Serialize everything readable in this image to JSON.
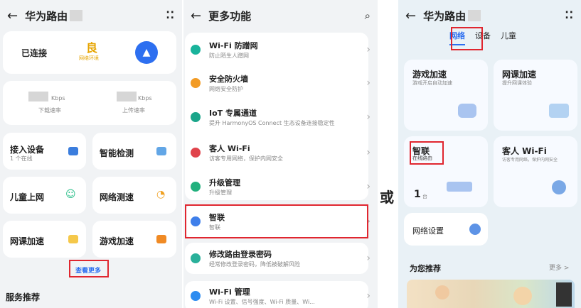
{
  "panel1": {
    "title": "华为路由",
    "connection": "已连接",
    "quality": "良",
    "quality_sub": "网络环境",
    "speed_unit": "Kbps",
    "download_label": "下载速率",
    "upload_label": "上传速率",
    "devices": {
      "label": "接入设备",
      "count": "1 个在线"
    },
    "tiles": [
      "智能检测",
      "儿童上网",
      "网络测速",
      "网课加速",
      "游戏加速"
    ],
    "more_link": "查看更多",
    "section": "服务推荐"
  },
  "panel2": {
    "title": "更多功能",
    "items": [
      {
        "title": "Wi-Fi 防蹭网",
        "desc": "防止陌生人蹭网",
        "color": "#19b39b"
      },
      {
        "title": "安全防火墙",
        "desc": "网络安全防护",
        "color": "#f29b25"
      },
      {
        "title": "IoT 专属通道",
        "desc": "提升 HarmonyOS Connect 生态设备连接稳定性",
        "color": "#1aa58a"
      },
      {
        "title": "客人 Wi-Fi",
        "desc": "访客专用网络，保护内网安全",
        "color": "#e0434b"
      },
      {
        "title": "升级管理",
        "desc": "升级管理",
        "color": "#22b07d"
      },
      {
        "title": "智联",
        "desc": "智联",
        "color": "#3f7fea"
      },
      {
        "title": "修改路由登录密码",
        "desc": "经常修改登录密码，降低被破解风险",
        "color": "#2ab09a"
      },
      {
        "title": "Wi-Fi 管理",
        "desc": "Wi-Fi 设置、信号强度、Wi-Fi 质量、Wi...",
        "color": "#2d8cf0"
      }
    ]
  },
  "or_text": "或",
  "panel3": {
    "title": "华为路由",
    "tabs": [
      "网络",
      "设备",
      "儿童"
    ],
    "game": {
      "title": "游戏加速",
      "desc": "游戏开启自动加速"
    },
    "class": {
      "title": "网课加速",
      "desc": "提升网课体验"
    },
    "smart": {
      "title": "智联",
      "desc": "在线路由",
      "count": "1",
      "unit": "台"
    },
    "guest": {
      "title": "客人 Wi-Fi",
      "desc": "访客专用网络，保护内网安全"
    },
    "netset": "网络设置",
    "recommend": "为您推荐",
    "more": "更多 >"
  }
}
